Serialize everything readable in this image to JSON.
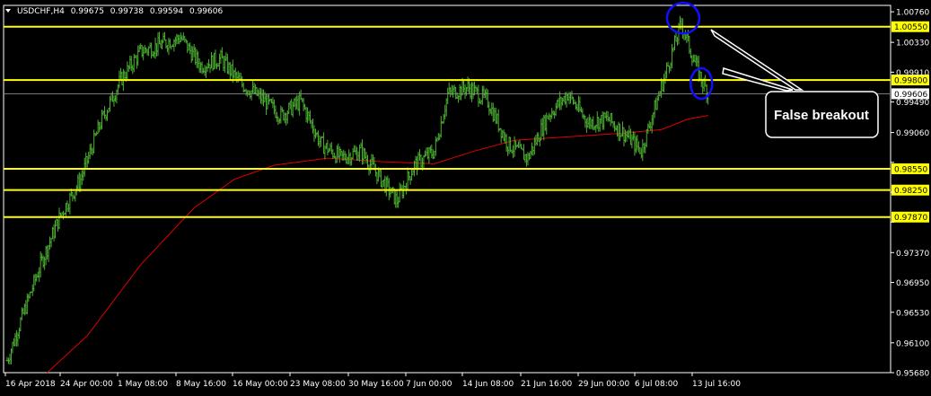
{
  "header": {
    "symbol": "USDCHF,H4",
    "open": "0.99675",
    "high": "0.99738",
    "low": "0.99594",
    "close": "0.99606"
  },
  "colors": {
    "background": "#000000",
    "frame": "#ffffff",
    "bar": "#4caf32",
    "moving_average": "#e00000",
    "level": "#ffff00",
    "marker": "#1010ff",
    "annotation": "#ffffff"
  },
  "chart_data": {
    "type": "ohlc",
    "title": "",
    "xlabel": "",
    "ylabel": "",
    "ylim": [
      0.9568,
      1.0085
    ],
    "grid": false,
    "y_ticks": [
      "1.00760",
      "1.00330",
      "0.99910",
      "0.99490",
      "0.99060",
      "0.98640",
      "0.98220",
      "0.97800",
      "0.97370",
      "0.96950",
      "0.96530",
      "0.96100",
      "0.95680"
    ],
    "x_ticks": [
      "16 Apr 2018",
      "24 Apr 00:00",
      "1 May 08:00",
      "8 May 16:00",
      "16 May 00:00",
      "23 May 08:00",
      "30 May 16:00",
      "7 Jun 00:00",
      "14 Jun 08:00",
      "21 Jun 16:00",
      "29 Jun 00:00",
      "6 Jul 08:00",
      "13 Jul 16:00"
    ],
    "horizontal_levels": [
      "1.00550",
      "0.99800",
      "0.98550",
      "0.98250",
      "0.97870"
    ],
    "current_price": "0.99606",
    "price_path": [
      {
        "bar": 0,
        "close": 0.9585
      },
      {
        "bar": 10,
        "close": 0.964
      },
      {
        "bar": 25,
        "close": 0.972
      },
      {
        "bar": 40,
        "close": 0.979
      },
      {
        "bar": 55,
        "close": 0.984
      },
      {
        "bar": 70,
        "close": 0.992
      },
      {
        "bar": 85,
        "close": 0.998
      },
      {
        "bar": 100,
        "close": 1.002
      },
      {
        "bar": 115,
        "close": 1.003
      },
      {
        "bar": 130,
        "close": 1.004
      },
      {
        "bar": 145,
        "close": 1.0
      },
      {
        "bar": 160,
        "close": 1.001
      },
      {
        "bar": 175,
        "close": 0.9975
      },
      {
        "bar": 190,
        "close": 0.9955
      },
      {
        "bar": 205,
        "close": 0.993
      },
      {
        "bar": 220,
        "close": 0.995
      },
      {
        "bar": 235,
        "close": 0.989
      },
      {
        "bar": 250,
        "close": 0.987
      },
      {
        "bar": 265,
        "close": 0.988
      },
      {
        "bar": 280,
        "close": 0.984
      },
      {
        "bar": 292,
        "close": 0.981
      },
      {
        "bar": 305,
        "close": 0.986
      },
      {
        "bar": 320,
        "close": 0.988
      },
      {
        "bar": 330,
        "close": 0.996
      },
      {
        "bar": 345,
        "close": 0.997
      },
      {
        "bar": 360,
        "close": 0.995
      },
      {
        "bar": 375,
        "close": 0.989
      },
      {
        "bar": 390,
        "close": 0.987
      },
      {
        "bar": 405,
        "close": 0.993
      },
      {
        "bar": 420,
        "close": 0.996
      },
      {
        "bar": 435,
        "close": 0.992
      },
      {
        "bar": 450,
        "close": 0.9925
      },
      {
        "bar": 465,
        "close": 0.99
      },
      {
        "bar": 475,
        "close": 0.988
      },
      {
        "bar": 485,
        "close": 0.994
      },
      {
        "bar": 495,
        "close": 1.0
      },
      {
        "bar": 505,
        "close": 1.006
      },
      {
        "bar": 512,
        "close": 1.002
      },
      {
        "bar": 520,
        "close": 0.998
      },
      {
        "bar": 525,
        "close": 0.9961
      }
    ],
    "moving_average": [
      {
        "bar": 30,
        "value": 0.9568
      },
      {
        "bar": 60,
        "value": 0.962
      },
      {
        "bar": 100,
        "value": 0.972
      },
      {
        "bar": 140,
        "value": 0.98
      },
      {
        "bar": 170,
        "value": 0.984
      },
      {
        "bar": 200,
        "value": 0.986
      },
      {
        "bar": 240,
        "value": 0.987
      },
      {
        "bar": 280,
        "value": 0.9865
      },
      {
        "bar": 320,
        "value": 0.9862
      },
      {
        "bar": 350,
        "value": 0.988
      },
      {
        "bar": 380,
        "value": 0.9895
      },
      {
        "bar": 420,
        "value": 0.99
      },
      {
        "bar": 460,
        "value": 0.9905
      },
      {
        "bar": 490,
        "value": 0.991
      },
      {
        "bar": 510,
        "value": 0.9925
      },
      {
        "bar": 525,
        "value": 0.993
      }
    ],
    "annotation": {
      "text": "False breakout"
    }
  }
}
